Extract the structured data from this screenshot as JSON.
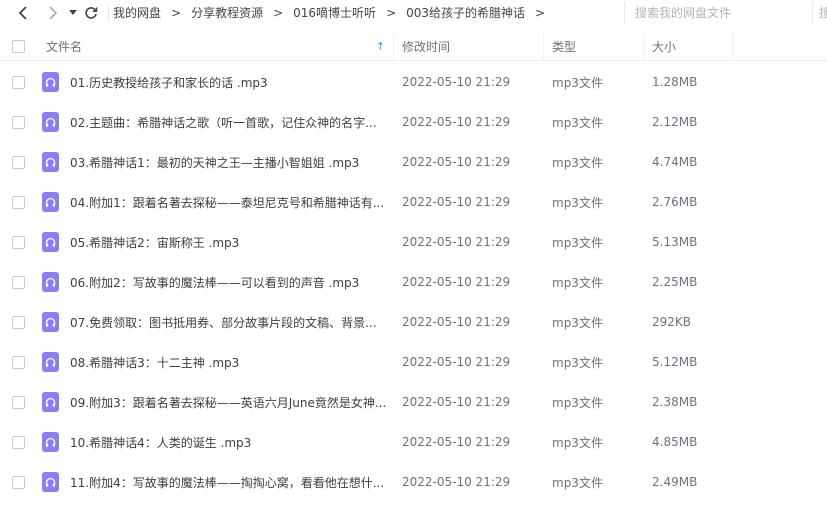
{
  "nav": {
    "back_icon": "chevron-left-icon",
    "forward_icon": "chevron-right-icon",
    "dropdown_icon": "caret-down-icon",
    "refresh_icon": "refresh-icon"
  },
  "breadcrumb": {
    "items": [
      "我的网盘",
      "分享教程资源",
      "016嘀博士听听",
      "003给孩子的希腊神话"
    ],
    "separator": ">"
  },
  "search": {
    "placeholder": "搜索我的网盘文件",
    "extra": "搜"
  },
  "table": {
    "headers": {
      "name": "文件名",
      "time": "修改时间",
      "type": "类型",
      "size": "大小"
    },
    "sort_indicator": "↑",
    "accent_color": "#2e8eff",
    "icon_color": "#8b7df4",
    "rows": [
      {
        "name": "01.历史教授给孩子和家长的话 .mp3",
        "time": "2022-05-10 21:29",
        "type": "mp3文件",
        "size": "1.28MB"
      },
      {
        "name": "02.主题曲：希腊神话之歌（听一首歌，记住众神的名字...",
        "time": "2022-05-10 21:29",
        "type": "mp3文件",
        "size": "2.12MB"
      },
      {
        "name": "03.希腊神话1：最初的天神之王—主播小智姐姐 .mp3",
        "time": "2022-05-10 21:29",
        "type": "mp3文件",
        "size": "4.74MB"
      },
      {
        "name": "04.附加1：跟着名著去探秘——泰坦尼克号和希腊神话有...",
        "time": "2022-05-10 21:29",
        "type": "mp3文件",
        "size": "2.76MB"
      },
      {
        "name": "05.希腊神话2：宙斯称王 .mp3",
        "time": "2022-05-10 21:29",
        "type": "mp3文件",
        "size": "5.13MB"
      },
      {
        "name": "06.附加2：写故事的魔法棒——可以看到的声音 .mp3",
        "time": "2022-05-10 21:29",
        "type": "mp3文件",
        "size": "2.25MB"
      },
      {
        "name": "07.免费领取：图书抵用券、部分故事片段的文稿、背景...",
        "time": "2022-05-10 21:29",
        "type": "mp3文件",
        "size": "292KB"
      },
      {
        "name": "08.希腊神话3：十二主神 .mp3",
        "time": "2022-05-10 21:29",
        "type": "mp3文件",
        "size": "5.12MB"
      },
      {
        "name": "09.附加3：跟着名著去探秘——英语六月June竟然是女神...",
        "time": "2022-05-10 21:29",
        "type": "mp3文件",
        "size": "2.38MB"
      },
      {
        "name": "10.希腊神话4：人类的诞生 .mp3",
        "time": "2022-05-10 21:29",
        "type": "mp3文件",
        "size": "4.85MB"
      },
      {
        "name": "11.附加4：写故事的魔法棒——掏掏心窝，看看他在想什...",
        "time": "2022-05-10 21:29",
        "type": "mp3文件",
        "size": "2.49MB"
      }
    ]
  }
}
